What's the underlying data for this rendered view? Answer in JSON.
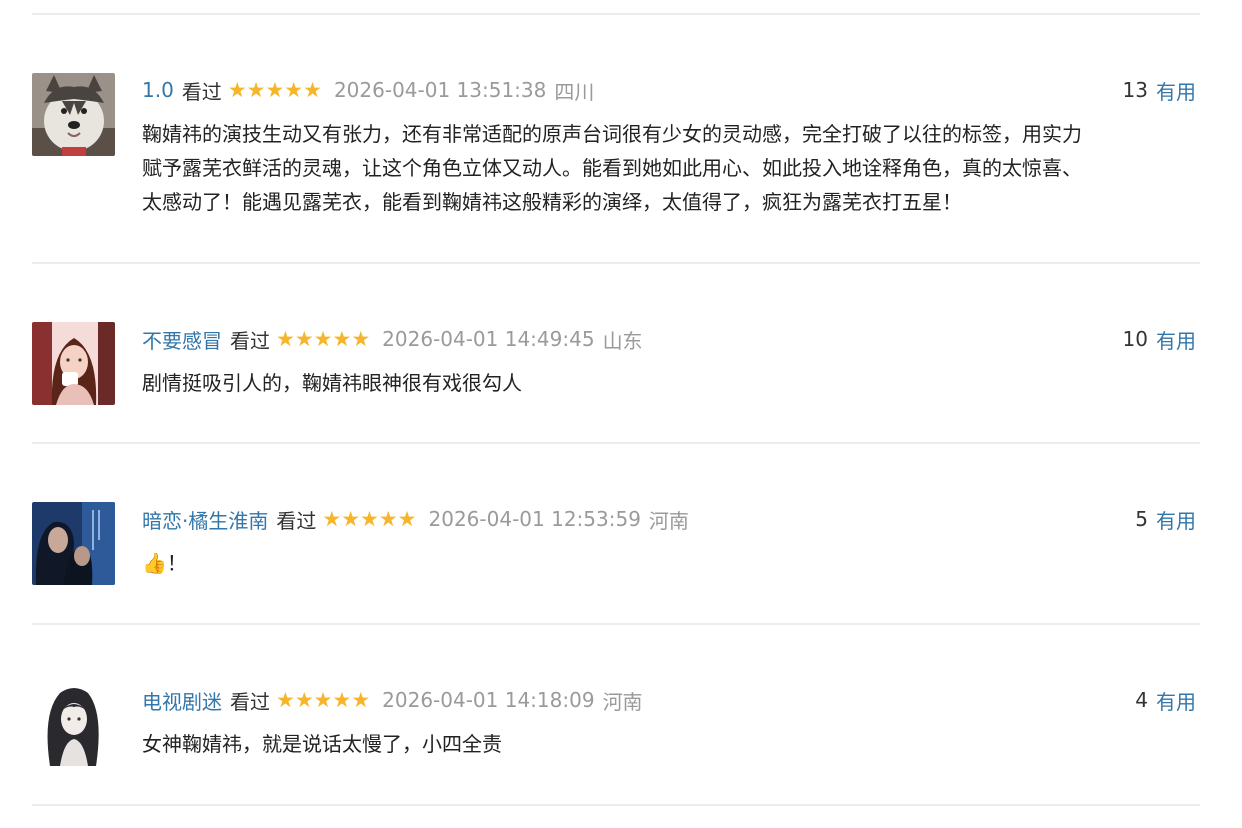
{
  "colors": {
    "link": "#3377aa",
    "star": "#f7b52b",
    "meta_gray": "#9a9a9a",
    "text": "#222222",
    "divider": "#ececec"
  },
  "reviews": [
    {
      "username": "1.0",
      "status": "看过",
      "rating": 5,
      "time": "2026-04-01 13:51:38",
      "region": "四川",
      "helpful_count": "13",
      "helpful_label": "有用",
      "avatar_icon": "husky-dog-avatar",
      "content": "鞠婧祎的演技生动又有张力，还有非常适配的原声台词很有少女的灵动感，完全打破了以往的标签，用实力\n赋予露芜衣鲜活的灵魂，让这个角色立体又动人。能看到她如此用心、如此投入地诠释角色，真的太惊喜、\n太感动了！能遇见露芜衣，能看到鞠婧祎这般精彩的演绎，太值得了，疯狂为露芜衣打五星！"
    },
    {
      "username": "不要感冒",
      "status": "看过",
      "rating": 5,
      "time": "2026-04-01 14:49:45",
      "region": "山东",
      "helpful_count": "10",
      "helpful_label": "有用",
      "avatar_icon": "girl-portrait-avatar",
      "content": "剧情挺吸引人的，鞠婧祎眼神很有戏很勾人"
    },
    {
      "username": "暗恋·橘生淮南",
      "status": "看过",
      "rating": 5,
      "time": "2026-04-01 12:53:59",
      "region": "河南",
      "helpful_count": "5",
      "helpful_label": "有用",
      "avatar_icon": "couple-scene-avatar",
      "content": "👍！"
    },
    {
      "username": "电视剧迷",
      "status": "看过",
      "rating": 5,
      "time": "2026-04-01 14:18:09",
      "region": "河南",
      "helpful_count": "4",
      "helpful_label": "有用",
      "avatar_icon": "anime-girl-avatar",
      "content": "女神鞠婧祎，就是说话太慢了，小四全责"
    }
  ]
}
